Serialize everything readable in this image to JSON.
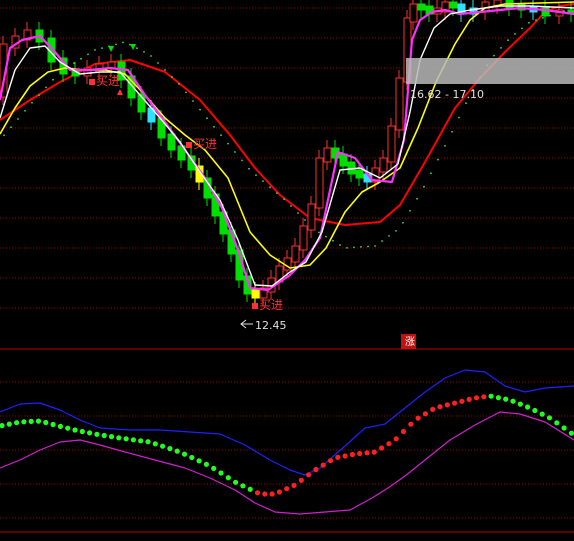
{
  "chart_data": [
    {
      "type": "candlestick",
      "title": "",
      "price_labels": {
        "low_marker": "12.45",
        "range_marker": "16.62 - 17.10"
      },
      "signal_labels": [
        "买进",
        "买进",
        "买进"
      ],
      "colors": {
        "background": "#000000",
        "up_candle": "#ff3030",
        "down_candle": "#00e000",
        "ma_white": "#ffffff",
        "ma_magenta": "#ff30ff",
        "ma_yellow": "#ffff00",
        "ma_red": "#ff0000",
        "cyan_highlight": "#30e0ff",
        "grid": "#9a0000"
      },
      "grid": true,
      "legend": "none"
    },
    {
      "type": "line",
      "title": "",
      "badge": "涨",
      "series_colors": {
        "upper": "#2020ff",
        "lower": "#d020d0",
        "dots_rising": "#ff2020",
        "dots_falling": "#20ff20"
      },
      "grid": true
    }
  ]
}
